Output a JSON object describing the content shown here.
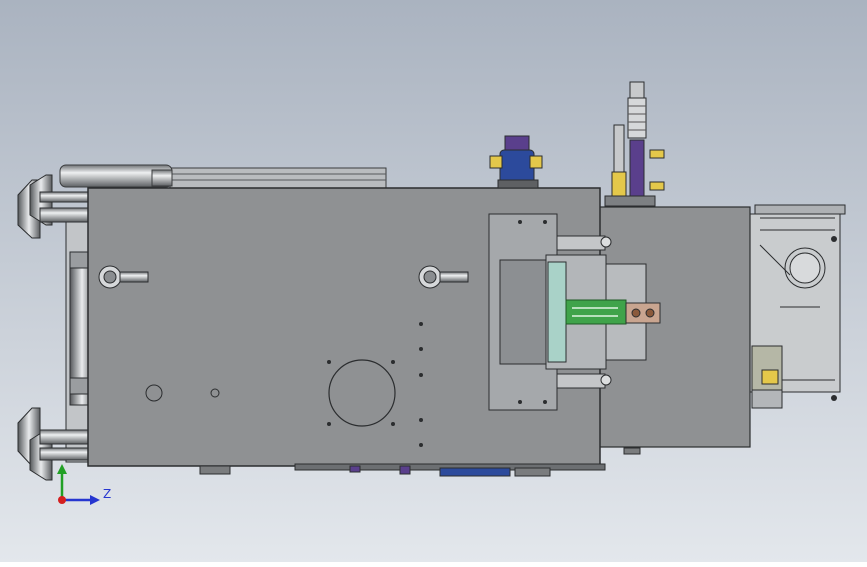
{
  "viewport": {
    "background_top": "#aab3c0",
    "background_bottom": "#e3e7ec"
  },
  "colors": {
    "body_fill": "#8f9193",
    "body_stroke": "#2b2d2f",
    "rail_fill": "#b9bcbf",
    "accent_green": "#3fa34a",
    "accent_purple": "#5a3f8c",
    "accent_blue": "#2c4a9c",
    "accent_yellow": "#e4c84a",
    "accent_brown": "#8b5a3c",
    "axis_green": "#21a025",
    "axis_blue": "#2636d0",
    "axis_red": "#d42020"
  },
  "triad": {
    "z_label": "Z"
  }
}
